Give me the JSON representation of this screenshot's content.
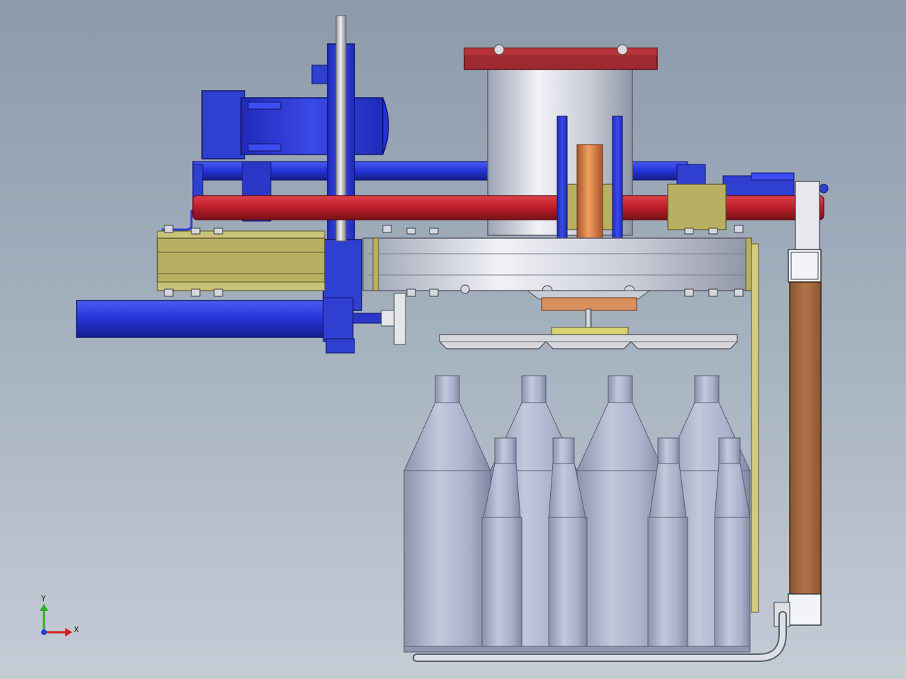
{
  "viewport": {
    "background_top": "#8c9aaa",
    "background_bottom": "#c4ccd6",
    "part_colors": {
      "frame_blue": "#2f3fd0",
      "tube_red": "#c0202a",
      "flange_red": "#9c2a30",
      "rail_olive": "#b7b062",
      "cylinder_silver": "#c9ccd6",
      "copper": "#c8743a",
      "bottle_gray": "#a9b0c8",
      "column_brown": "#a26a42"
    }
  },
  "triad": {
    "y_label": "Y",
    "x_label": "X",
    "y_color": "#2bb02b",
    "x_color": "#d42020",
    "z_color": "#2040d0"
  }
}
